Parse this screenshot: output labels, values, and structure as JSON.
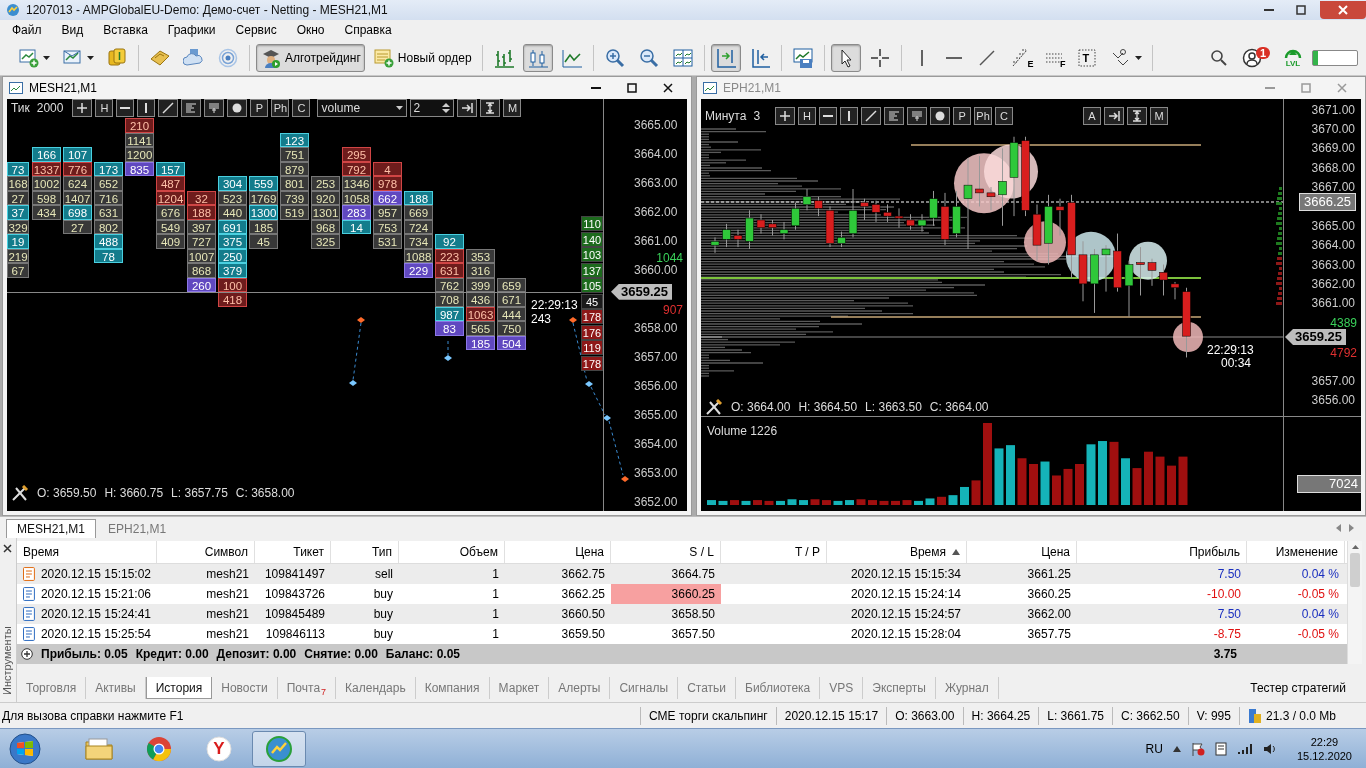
{
  "window": {
    "title": "1207013 - AMPGlobalEU-Demo: Демо-счет - Netting - MESH21,M1"
  },
  "menu": [
    "Файл",
    "Вид",
    "Вставка",
    "Графики",
    "Сервис",
    "Окно",
    "Справка"
  ],
  "toolbar": {
    "groups": [
      [
        {
          "kind": "new-chart",
          "pressed": false
        },
        {
          "kind": "profiles",
          "pressed": false
        },
        {
          "kind": "market",
          "pressed": false
        }
      ],
      [
        {
          "kind": "book",
          "pressed": false
        },
        {
          "kind": "cloud",
          "pressed": false
        },
        {
          "kind": "signal",
          "pressed": false
        }
      ],
      [
        {
          "kind": "algo",
          "label": "Алготрейдинг",
          "pressed": true
        },
        {
          "kind": "order",
          "label": "Новый ордер",
          "pressed": false
        }
      ],
      [
        {
          "kind": "bars",
          "pressed": false
        },
        {
          "kind": "candles",
          "pressed": true
        },
        {
          "kind": "line",
          "pressed": false
        }
      ],
      [
        {
          "kind": "zoom-in",
          "pressed": false
        },
        {
          "kind": "zoom-out",
          "pressed": false
        },
        {
          "kind": "tile",
          "pressed": false
        }
      ],
      [
        {
          "kind": "shift",
          "pressed": true
        },
        {
          "kind": "autoscroll",
          "pressed": false
        }
      ],
      [
        {
          "kind": "save",
          "pressed": false
        }
      ],
      [
        {
          "kind": "cursor",
          "pressed": true
        },
        {
          "kind": "crosshair",
          "pressed": false
        }
      ],
      [
        {
          "kind": "vline",
          "pressed": false
        },
        {
          "kind": "hline",
          "pressed": false
        },
        {
          "kind": "trend",
          "pressed": false
        },
        {
          "kind": "fibo",
          "label": "E",
          "pressed": false
        },
        {
          "kind": "fibo-grid",
          "label": "F",
          "pressed": false
        },
        {
          "kind": "text",
          "label": "T",
          "pressed": false
        },
        {
          "kind": "shapes",
          "pressed": false
        }
      ]
    ],
    "notifications": "1",
    "lvl": "LVL",
    "progress": {
      "level": 0.12
    }
  },
  "footprint_window": {
    "title": "MESH21,M1",
    "active": true,
    "period": "Тик",
    "period_value": "2000",
    "tools": [
      {
        "kind": "plus"
      },
      {
        "kind": "letter",
        "label": "H"
      },
      {
        "kind": "hline"
      },
      {
        "kind": "vline"
      },
      {
        "kind": "trend"
      },
      {
        "kind": "bars-left"
      },
      {
        "kind": "bars-t"
      },
      {
        "kind": "dot"
      },
      {
        "kind": "letter",
        "label": "P"
      },
      {
        "kind": "letter",
        "label": "Ph"
      },
      {
        "kind": "letter",
        "label": "C"
      }
    ],
    "indicator": "volume",
    "indicator_value": "2",
    "tools_right": [
      {
        "kind": "arrow"
      },
      {
        "kind": "ibeam"
      },
      {
        "kind": "letter",
        "label": "M"
      }
    ],
    "columns": [
      {
        "cells": [
          {
            "value": "73",
            "kind": "teal"
          },
          {
            "value": "168",
            "kind": "plain"
          },
          {
            "value": "27",
            "kind": "plain"
          },
          {
            "value": "37",
            "kind": "teal"
          },
          {
            "value": "329",
            "kind": "plain"
          },
          {
            "value": "19",
            "kind": "teal"
          },
          {
            "value": "219",
            "kind": "plain"
          },
          {
            "value": "67",
            "kind": "plain"
          }
        ]
      },
      {
        "cells": [
          {
            "value": "166",
            "kind": "teal"
          },
          {
            "value": "1337",
            "kind": "red"
          },
          {
            "value": "1002",
            "kind": "plain"
          },
          {
            "value": "598",
            "kind": "plain"
          },
          {
            "value": "434",
            "kind": "plain"
          }
        ]
      },
      {
        "cells": [
          {
            "value": "107",
            "kind": "teal"
          },
          {
            "value": "776",
            "kind": "red"
          },
          {
            "value": "624",
            "kind": "plain"
          },
          {
            "value": "1407",
            "kind": "plain"
          },
          {
            "value": "698",
            "kind": "teal"
          },
          {
            "value": "27",
            "kind": "plain"
          }
        ]
      },
      {
        "cells": [
          {
            "value": "173",
            "kind": "teal"
          },
          {
            "value": "652",
            "kind": "plain"
          },
          {
            "value": "716",
            "kind": "plain"
          },
          {
            "value": "631",
            "kind": "plain"
          },
          {
            "value": "802",
            "kind": "plain"
          },
          {
            "value": "488",
            "kind": "teal"
          },
          {
            "value": "78",
            "kind": "teal"
          }
        ]
      },
      {
        "cells": [
          {
            "value": "210",
            "kind": "red"
          },
          {
            "value": "1141",
            "kind": "plain"
          },
          {
            "value": "1200",
            "kind": "plain"
          },
          {
            "value": "835",
            "kind": "purple"
          }
        ]
      },
      {
        "cells": [
          {
            "value": "157",
            "kind": "teal"
          },
          {
            "value": "487",
            "kind": "red"
          },
          {
            "value": "1204",
            "kind": "red"
          },
          {
            "value": "676",
            "kind": "plain"
          },
          {
            "value": "549",
            "kind": "plain"
          },
          {
            "value": "409",
            "kind": "plain"
          }
        ]
      },
      {
        "cells": [
          {
            "value": "32",
            "kind": "red"
          },
          {
            "value": "188",
            "kind": "red"
          },
          {
            "value": "397",
            "kind": "plain"
          },
          {
            "value": "727",
            "kind": "plain"
          },
          {
            "value": "1007",
            "kind": "plain"
          },
          {
            "value": "868",
            "kind": "plain"
          },
          {
            "value": "260",
            "kind": "purple"
          }
        ]
      },
      {
        "cells": [
          {
            "value": "304",
            "kind": "teal"
          },
          {
            "value": "523",
            "kind": "plain"
          },
          {
            "value": "440",
            "kind": "plain"
          },
          {
            "value": "691",
            "kind": "teal"
          },
          {
            "value": "375",
            "kind": "teal"
          },
          {
            "value": "250",
            "kind": "teal"
          },
          {
            "value": "379",
            "kind": "teal"
          },
          {
            "value": "100",
            "kind": "red"
          },
          {
            "value": "418",
            "kind": "red"
          }
        ]
      },
      {
        "cells": [
          {
            "value": "559",
            "kind": "teal"
          },
          {
            "value": "1769",
            "kind": "plain"
          },
          {
            "value": "1300",
            "kind": "teal"
          },
          {
            "value": "185",
            "kind": "plain"
          },
          {
            "value": "45",
            "kind": "plain"
          }
        ]
      },
      {
        "cells": [
          {
            "value": "123",
            "kind": "teal"
          },
          {
            "value": "751",
            "kind": "plain"
          },
          {
            "value": "879",
            "kind": "plain"
          },
          {
            "value": "801",
            "kind": "plain"
          },
          {
            "value": "739",
            "kind": "plain"
          },
          {
            "value": "519",
            "kind": "plain"
          }
        ]
      },
      {
        "cells": [
          {
            "value": "253",
            "kind": "plain"
          },
          {
            "value": "920",
            "kind": "plain"
          },
          {
            "value": "1301",
            "kind": "plain"
          },
          {
            "value": "968",
            "kind": "plain"
          },
          {
            "value": "325",
            "kind": "plain"
          }
        ]
      },
      {
        "cells": [
          {
            "value": "295",
            "kind": "red"
          },
          {
            "value": "792",
            "kind": "red"
          },
          {
            "value": "1346",
            "kind": "plain"
          },
          {
            "value": "1058",
            "kind": "plain"
          },
          {
            "value": "283",
            "kind": "purple"
          },
          {
            "value": "14",
            "kind": "teal"
          }
        ]
      },
      {
        "cells": [
          {
            "value": "4",
            "kind": "red"
          },
          {
            "value": "978",
            "kind": "red"
          },
          {
            "value": "662",
            "kind": "purple"
          },
          {
            "value": "957",
            "kind": "plain"
          },
          {
            "value": "753",
            "kind": "plain"
          },
          {
            "value": "531",
            "kind": "plain"
          }
        ]
      },
      {
        "cells": [
          {
            "value": "188",
            "kind": "teal"
          },
          {
            "value": "669",
            "kind": "plain"
          },
          {
            "value": "724",
            "kind": "plain"
          },
          {
            "value": "734",
            "kind": "plain"
          },
          {
            "value": "1088",
            "kind": "plain"
          },
          {
            "value": "229",
            "kind": "purple"
          }
        ]
      },
      {
        "cells": [
          {
            "value": "92",
            "kind": "teal"
          },
          {
            "value": "223",
            "kind": "red"
          },
          {
            "value": "631",
            "kind": "red"
          },
          {
            "value": "762",
            "kind": "plain"
          },
          {
            "value": "708",
            "kind": "plain"
          },
          {
            "value": "987",
            "kind": "teal"
          },
          {
            "value": "83",
            "kind": "purple"
          }
        ]
      },
      {
        "cells": [
          {
            "value": "353",
            "kind": "plain"
          },
          {
            "value": "316",
            "kind": "plain"
          },
          {
            "value": "399",
            "kind": "plain"
          },
          {
            "value": "436",
            "kind": "plain"
          },
          {
            "value": "1063",
            "kind": "red"
          },
          {
            "value": "565",
            "kind": "plain"
          },
          {
            "value": "185",
            "kind": "purple"
          }
        ]
      },
      {
        "cells": [
          {
            "value": "659",
            "kind": "plain"
          },
          {
            "value": "671",
            "kind": "plain"
          },
          {
            "value": "444",
            "kind": "plain"
          },
          {
            "value": "750",
            "kind": "plain"
          },
          {
            "value": "504",
            "kind": "purple"
          }
        ]
      }
    ],
    "dom": [
      {
        "value": "110",
        "kind": "bid"
      },
      {
        "value": "140",
        "kind": "bid"
      },
      {
        "value": "103",
        "kind": "bid"
      },
      {
        "value": "137",
        "kind": "bid"
      },
      {
        "value": "105",
        "kind": "bid"
      },
      {
        "value": "45",
        "kind": "last"
      },
      {
        "value": "178",
        "kind": "ask"
      },
      {
        "value": "176",
        "kind": "ask"
      },
      {
        "value": "119",
        "kind": "ask"
      },
      {
        "value": "178",
        "kind": "ask"
      }
    ],
    "delta_up": "1044",
    "delta_down": "907",
    "axis": [
      "3665.00",
      "3664.00",
      "3663.00",
      "3662.00",
      "3661.00",
      "3660.00",
      "3658.00",
      "3657.00",
      "3656.00",
      "3655.00",
      "3654.00",
      "3653.00",
      "3652.00"
    ],
    "price": "3659.25",
    "time": "22:29:13",
    "time_sub": "243",
    "ohlc": [
      "O: 3659.50",
      "H: 3660.75",
      "L: 3657.75",
      "C: 3658.00"
    ]
  },
  "candle_window": {
    "title": "EPH21,M1",
    "active": false,
    "period": "Минута",
    "period_value": "3",
    "tools": [
      {
        "kind": "plus"
      },
      {
        "kind": "letter",
        "label": "H"
      },
      {
        "kind": "hline"
      },
      {
        "kind": "vline"
      },
      {
        "kind": "trend"
      },
      {
        "kind": "bars-left"
      },
      {
        "kind": "bars-t"
      },
      {
        "kind": "dot"
      },
      {
        "kind": "letter",
        "label": "P"
      },
      {
        "kind": "letter",
        "label": "Ph"
      },
      {
        "kind": "letter",
        "label": "C"
      }
    ],
    "tools_right": [
      {
        "kind": "letter",
        "label": "A"
      },
      {
        "kind": "arrow"
      },
      {
        "kind": "ibeam"
      },
      {
        "kind": "letter",
        "label": "M"
      }
    ],
    "axis": [
      "3671.00",
      "3670.00",
      "3669.00",
      "3668.00",
      "3667.00",
      "3665.00",
      "3664.00",
      "3663.00",
      "3662.00",
      "3661.00",
      "3657.00",
      "3656.00"
    ],
    "level_price": "3666.25",
    "price": "3659.25",
    "delta_up": "4389",
    "delta_down": "4792",
    "time": "22:29:13",
    "time_sub": "00:34",
    "ohlc": [
      "O: 3664.00",
      "H: 3664.50",
      "L: 3663.50",
      "C: 3664.00"
    ],
    "volume_title": "Volume 1226",
    "volume_value": "7024"
  },
  "chart_tabs": [
    {
      "label": "MESH21,M1",
      "selected": true
    },
    {
      "label": "EPH21,M1",
      "selected": false
    }
  ],
  "terminal": {
    "side_label": "Инструменты",
    "columns": [
      {
        "label": "Время",
        "sorted": false
      },
      {
        "label": "Символ",
        "sorted": false
      },
      {
        "label": "Тикет",
        "sorted": false
      },
      {
        "label": "Тип",
        "sorted": false
      },
      {
        "label": "Объем",
        "sorted": false
      },
      {
        "label": "Цена",
        "sorted": false
      },
      {
        "label": "S / L",
        "sorted": false
      },
      {
        "label": "T / P",
        "sorted": false
      },
      {
        "label": "Время",
        "sorted": true
      },
      {
        "label": "Цена",
        "sorted": false
      },
      {
        "label": "Прибыль",
        "sorted": false
      },
      {
        "label": "Изменение",
        "sorted": false
      }
    ],
    "rows": [
      {
        "kind": "sell",
        "sl_hit": false,
        "loss": false,
        "cells": [
          "2020.12.15 15:15:02",
          "mesh21",
          "109841497",
          "sell",
          "1",
          "3662.75",
          "3664.75",
          "",
          "2020.12.15 15:15:34",
          "3661.25",
          "7.50",
          "0.04 %"
        ]
      },
      {
        "kind": "buy",
        "sl_hit": true,
        "loss": true,
        "cells": [
          "2020.12.15 15:21:06",
          "mesh21",
          "109843726",
          "buy",
          "1",
          "3662.25",
          "3660.25",
          "",
          "2020.12.15 15:24:14",
          "3660.25",
          "-10.00",
          "-0.05 %"
        ]
      },
      {
        "kind": "buy",
        "sl_hit": false,
        "loss": false,
        "cells": [
          "2020.12.15 15:24:41",
          "mesh21",
          "109845489",
          "buy",
          "1",
          "3660.50",
          "3658.50",
          "",
          "2020.12.15 15:24:57",
          "3662.00",
          "7.50",
          "0.04 %"
        ]
      },
      {
        "kind": "buy",
        "sl_hit": false,
        "loss": true,
        "cells": [
          "2020.12.15 15:25:54",
          "mesh21",
          "109846113",
          "buy",
          "1",
          "3659.50",
          "3657.50",
          "",
          "2020.12.15 15:28:04",
          "3657.75",
          "-8.75",
          "-0.05 %"
        ]
      }
    ],
    "summary": [
      "Прибыль: 0.05",
      "Кредит: 0.00",
      "Депозит: 0.00",
      "Снятие: 0.00",
      "Баланс: 0.05"
    ],
    "summary_total": "3.75",
    "tabs": [
      {
        "label": "Торговля",
        "selected": false
      },
      {
        "label": "Активы",
        "selected": false
      },
      {
        "label": "История",
        "selected": true
      },
      {
        "label": "Новости",
        "selected": false
      },
      {
        "label": "Почта",
        "selected": false,
        "badge": "7"
      },
      {
        "label": "Календарь",
        "selected": false
      },
      {
        "label": "Компания",
        "selected": false
      },
      {
        "label": "Маркет",
        "selected": false
      },
      {
        "label": "Алерты",
        "selected": false
      },
      {
        "label": "Сигналы",
        "selected": false
      },
      {
        "label": "Статьи",
        "selected": false
      },
      {
        "label": "Библиотека",
        "selected": false
      },
      {
        "label": "VPS",
        "selected": false
      },
      {
        "label": "Эксперты",
        "selected": false
      },
      {
        "label": "Журнал",
        "selected": false
      }
    ],
    "tester": "Тестер стратегий"
  },
  "status_bar": {
    "hint": "Для вызова справки нажмите F1",
    "fields": [
      "CME торги скальпинг",
      "2020.12.15 15:17",
      "O: 3663.00",
      "H: 3664.25",
      "L: 3661.75",
      "C: 3662.50",
      "V: 995"
    ],
    "traffic": "21.3 / 0.0 Mb"
  },
  "taskbar": {
    "apps": [
      {
        "kind": "folder",
        "active": false
      },
      {
        "kind": "round-browser",
        "active": false
      },
      {
        "kind": "letter-browser",
        "glyph": "Y",
        "active": false
      },
      {
        "kind": "trader",
        "active": true
      }
    ],
    "language": "RU",
    "time": "22:29",
    "date": "15.12.2020"
  }
}
